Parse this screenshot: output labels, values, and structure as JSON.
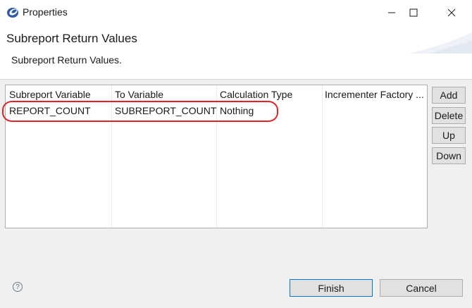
{
  "window": {
    "title": "Properties",
    "controls": {
      "minimize_icon": "minimize-icon",
      "maximize_icon": "maximize-icon",
      "close_icon": "close-icon"
    }
  },
  "header": {
    "title": "Subreport Return Values",
    "description": "Subreport Return Values."
  },
  "table": {
    "columns": [
      "Subreport Variable",
      "To Variable",
      "Calculation Type",
      "Incrementer Factory ..."
    ],
    "rows": [
      [
        "REPORT_COUNT",
        "SUBREPORT_COUNT",
        "Nothing",
        ""
      ]
    ]
  },
  "side_buttons": [
    "Add",
    "Delete",
    "Up",
    "Down"
  ],
  "footer": {
    "help_icon": "help-icon",
    "help_glyph": "?",
    "finish_label": "Finish",
    "cancel_label": "Cancel"
  },
  "colors": {
    "highlight": "#e0242a",
    "default_button_border": "#0078d7"
  }
}
